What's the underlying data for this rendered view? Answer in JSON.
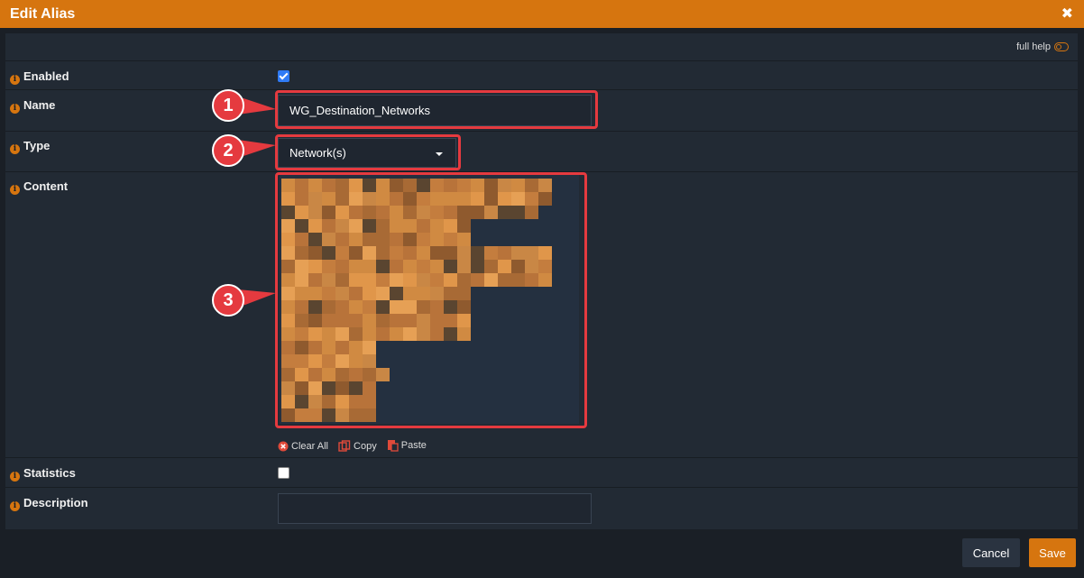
{
  "dialog": {
    "title": "Edit Alias",
    "close_glyph": "✖",
    "full_help_label": "full help"
  },
  "fields": {
    "enabled": {
      "label": "Enabled",
      "checked": true
    },
    "name": {
      "label": "Name",
      "value": "WG_Destination_Networks"
    },
    "type": {
      "label": "Type",
      "value": "Network(s)"
    },
    "content": {
      "label": "Content"
    },
    "statistics": {
      "label": "Statistics",
      "checked": false
    },
    "description": {
      "label": "Description",
      "value": ""
    }
  },
  "content_actions": {
    "clear_all": "Clear All",
    "copy": "Copy",
    "paste": "Paste"
  },
  "callouts": [
    "1",
    "2",
    "3"
  ],
  "footer": {
    "cancel": "Cancel",
    "save": "Save"
  },
  "colors": {
    "accent": "#d6750f",
    "annotation_red": "#e53a3f",
    "panel": "#222a34",
    "background": "#1a1f26"
  },
  "icons": [
    "info-icon",
    "close-icon",
    "toggle-icon",
    "clear-icon",
    "copy-icon",
    "paste-icon",
    "caret-down-icon"
  ]
}
